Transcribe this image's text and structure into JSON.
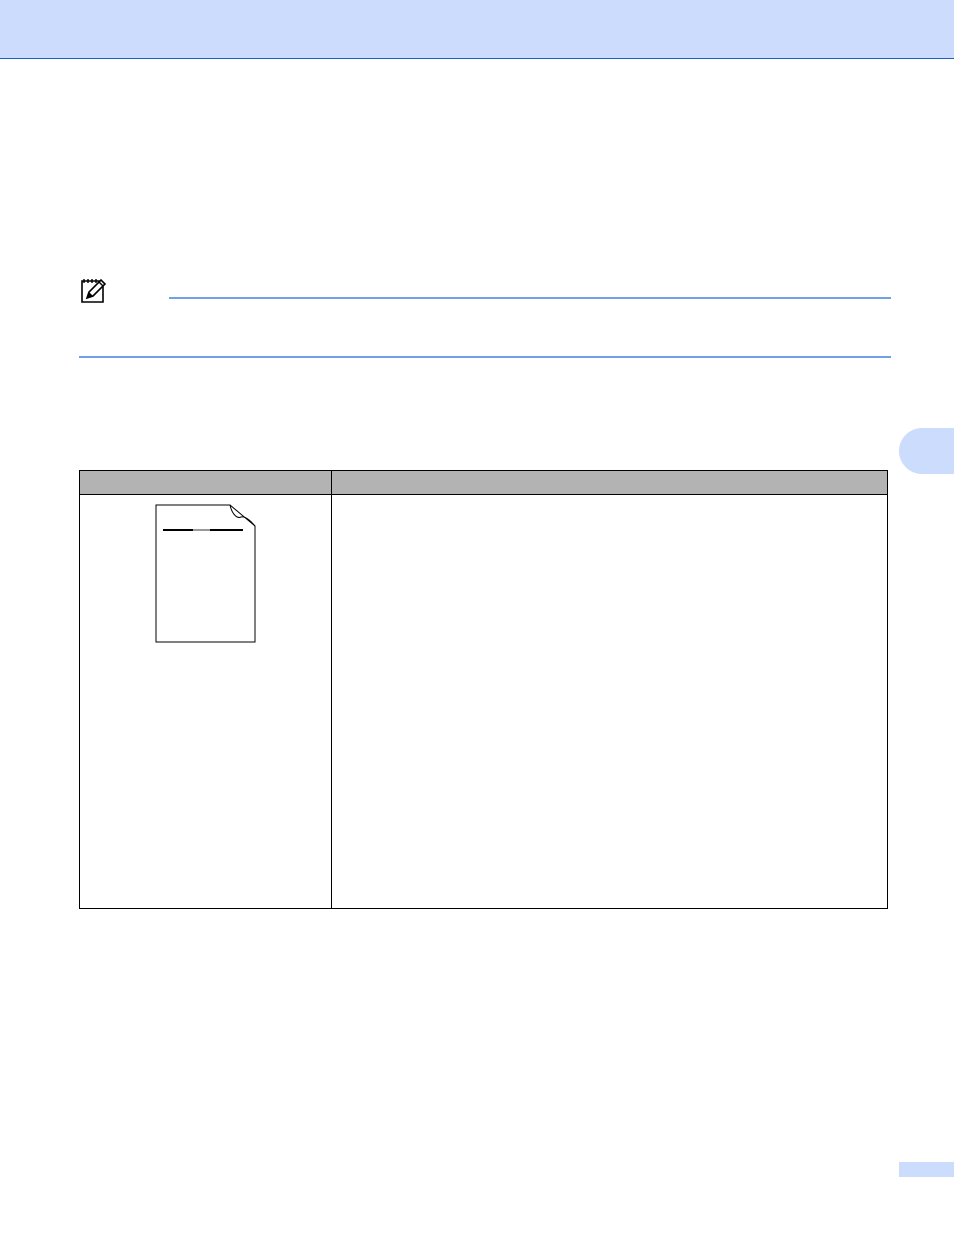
{
  "colors": {
    "header_band": "#cbdcfc",
    "header_rule": "#1f5fc4",
    "note_rule": "#6fa0e8",
    "table_header": "#b3b3b3"
  },
  "note": {
    "icon": "pencil-note-icon"
  },
  "table": {
    "headers": [
      "",
      ""
    ],
    "rows": [
      {
        "sample": "sample-page-with-line-illustration",
        "text": ""
      }
    ]
  }
}
